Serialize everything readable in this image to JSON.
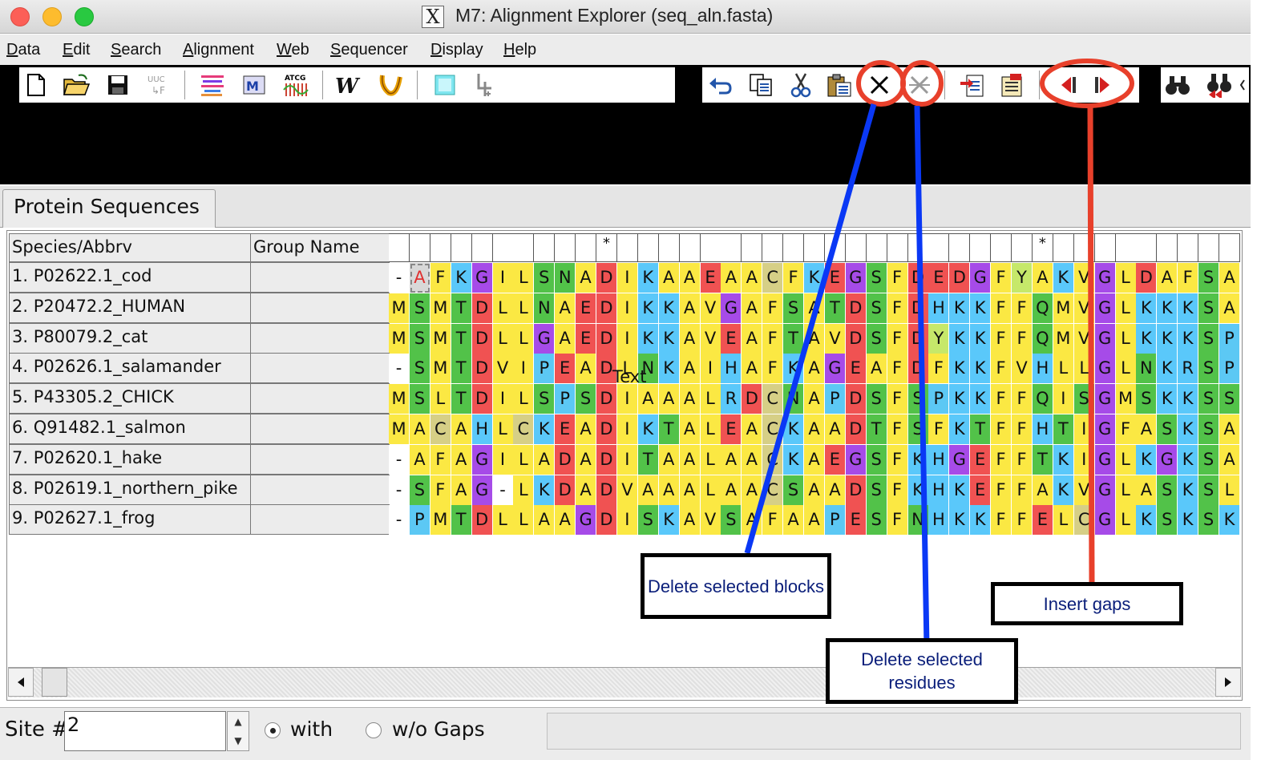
{
  "window": {
    "title_glyph": "X",
    "title": "M7: Alignment Explorer (seq_aln.fasta)"
  },
  "menu": [
    {
      "u": "D",
      "rest": "ata"
    },
    {
      "u": "E",
      "rest": "dit"
    },
    {
      "u": "S",
      "rest": "earch"
    },
    {
      "u": "A",
      "rest": "lignment"
    },
    {
      "u": "W",
      "rest": "eb"
    },
    {
      "u": "S",
      "rest": "equencer"
    },
    {
      "u": "D",
      "rest": "isplay"
    },
    {
      "u": "H",
      "rest": "elp"
    }
  ],
  "toolbar_icons": [
    "new-file-icon",
    "open-folder-icon",
    "save-icon",
    "translate-icon",
    "align-icon",
    "muscle-icon",
    "atcg-icon",
    "clustalw-icon",
    "muscle-worm-icon",
    "mark-icon",
    "trace-icon",
    "undo-icon",
    "copy-icon",
    "cut-icon",
    "paste-icon",
    "delete-block-icon",
    "delete-residues-icon",
    "export-icon",
    "import-icon",
    "insert-gap-left-icon",
    "insert-gap-right-icon",
    "find-icon",
    "find-previous-icon"
  ],
  "toolbar_labels": {
    "translate": "UUC\n↳F",
    "atcg": "ATCG",
    "clustalw": "W"
  },
  "tab": {
    "label": "Protein Sequences"
  },
  "grid": {
    "headers": {
      "species": "Species/Abbrv",
      "group": "Group Name"
    },
    "conservation": [
      "",
      "",
      "",
      "",
      "",
      "",
      "",
      "",
      "",
      "",
      "*",
      "",
      "",
      "",
      "",
      "",
      "",
      "",
      "",
      "",
      "",
      "",
      "",
      "",
      "",
      "",
      "",
      "",
      "",
      "",
      "",
      "*",
      "",
      "",
      "",
      "",
      "",
      "",
      "",
      "",
      "",
      "",
      "",
      "",
      "",
      "",
      "",
      "",
      "",
      "",
      ""
    ],
    "rows": [
      {
        "name": "1. P02622.1_cod",
        "seq": "-AFKGILSNADIKAAEAACFKEGSFDEDGFYAKVGLDAFSA"
      },
      {
        "name": "2. P20472.2_HUMAN",
        "seq": "MSMTDLLNAEDIKKAVGAFSATDSFDHKKFFQMVGLKKKSA"
      },
      {
        "name": "3. P80079.2_cat",
        "seq": "MSMTDLLGAEDIKKAVEAFTAVDSFDYKKFFQMVGLKKKSP"
      },
      {
        "name": "4. P02626.1_salamander",
        "seq": "-SMTDVIPEADLNKAIHAFKAGEAFDFKKFVHLLGLNKRSP"
      },
      {
        "name": "5. P43305.2_CHICK",
        "seq": "MSLTDILSPSDIAAALRDCNAPDSFSPKKFFQISGMSKKSS"
      },
      {
        "name": "6. Q91482.1_salmon",
        "seq": "MACAHLCKEADIKTALEACKAADTFSFKTFFHTIGFASKSA"
      },
      {
        "name": "7. P02620.1_hake",
        "seq": "-AFAGILADADITAALAACKAEGSFKHGEFFTKIGLKGKSA"
      },
      {
        "name": "8. P02619.1_northern_pike",
        "seq": "-SFAG-LKDADVAAALAACSAADSFKHKEFFAKVGLASKSL"
      },
      {
        "name": "9. P02627.1_frog",
        "seq": "-PMTDLLAAGDISKAVSAFAAPESFNHKKFFELCGLKSKSK"
      }
    ],
    "overlay_text": "Text"
  },
  "colors": {
    "A": "#fbe843",
    "F": "#fbe843",
    "Y": "#c6e86a",
    "L": "#fbe843",
    "I": "#fbe843",
    "V": "#fbe843",
    "M": "#fbe843",
    "C": "#d6cf86",
    "P": "#5cc8f4",
    "G": "#a64be8",
    "N": "#52c249",
    "S": "#52c249",
    "T": "#52c249",
    "Q": "#52c249",
    "K": "#5ac8fa",
    "R": "#5ac8fa",
    "H": "#5ac8fa",
    "D": "#f05252",
    "E": "#f05252",
    "-": "#ffffff",
    "annotation_red": "#e8402b",
    "annotation_blue": "#0a38f5"
  },
  "statusbar": {
    "site_label": "Site #",
    "site_value": "2",
    "radio_with": "with",
    "radio_without": "w/o Gaps"
  },
  "annotations": {
    "delete_blocks": "Delete selected blocks",
    "delete_residues": "Delete selected residues",
    "insert_gaps": "Insert gaps"
  }
}
